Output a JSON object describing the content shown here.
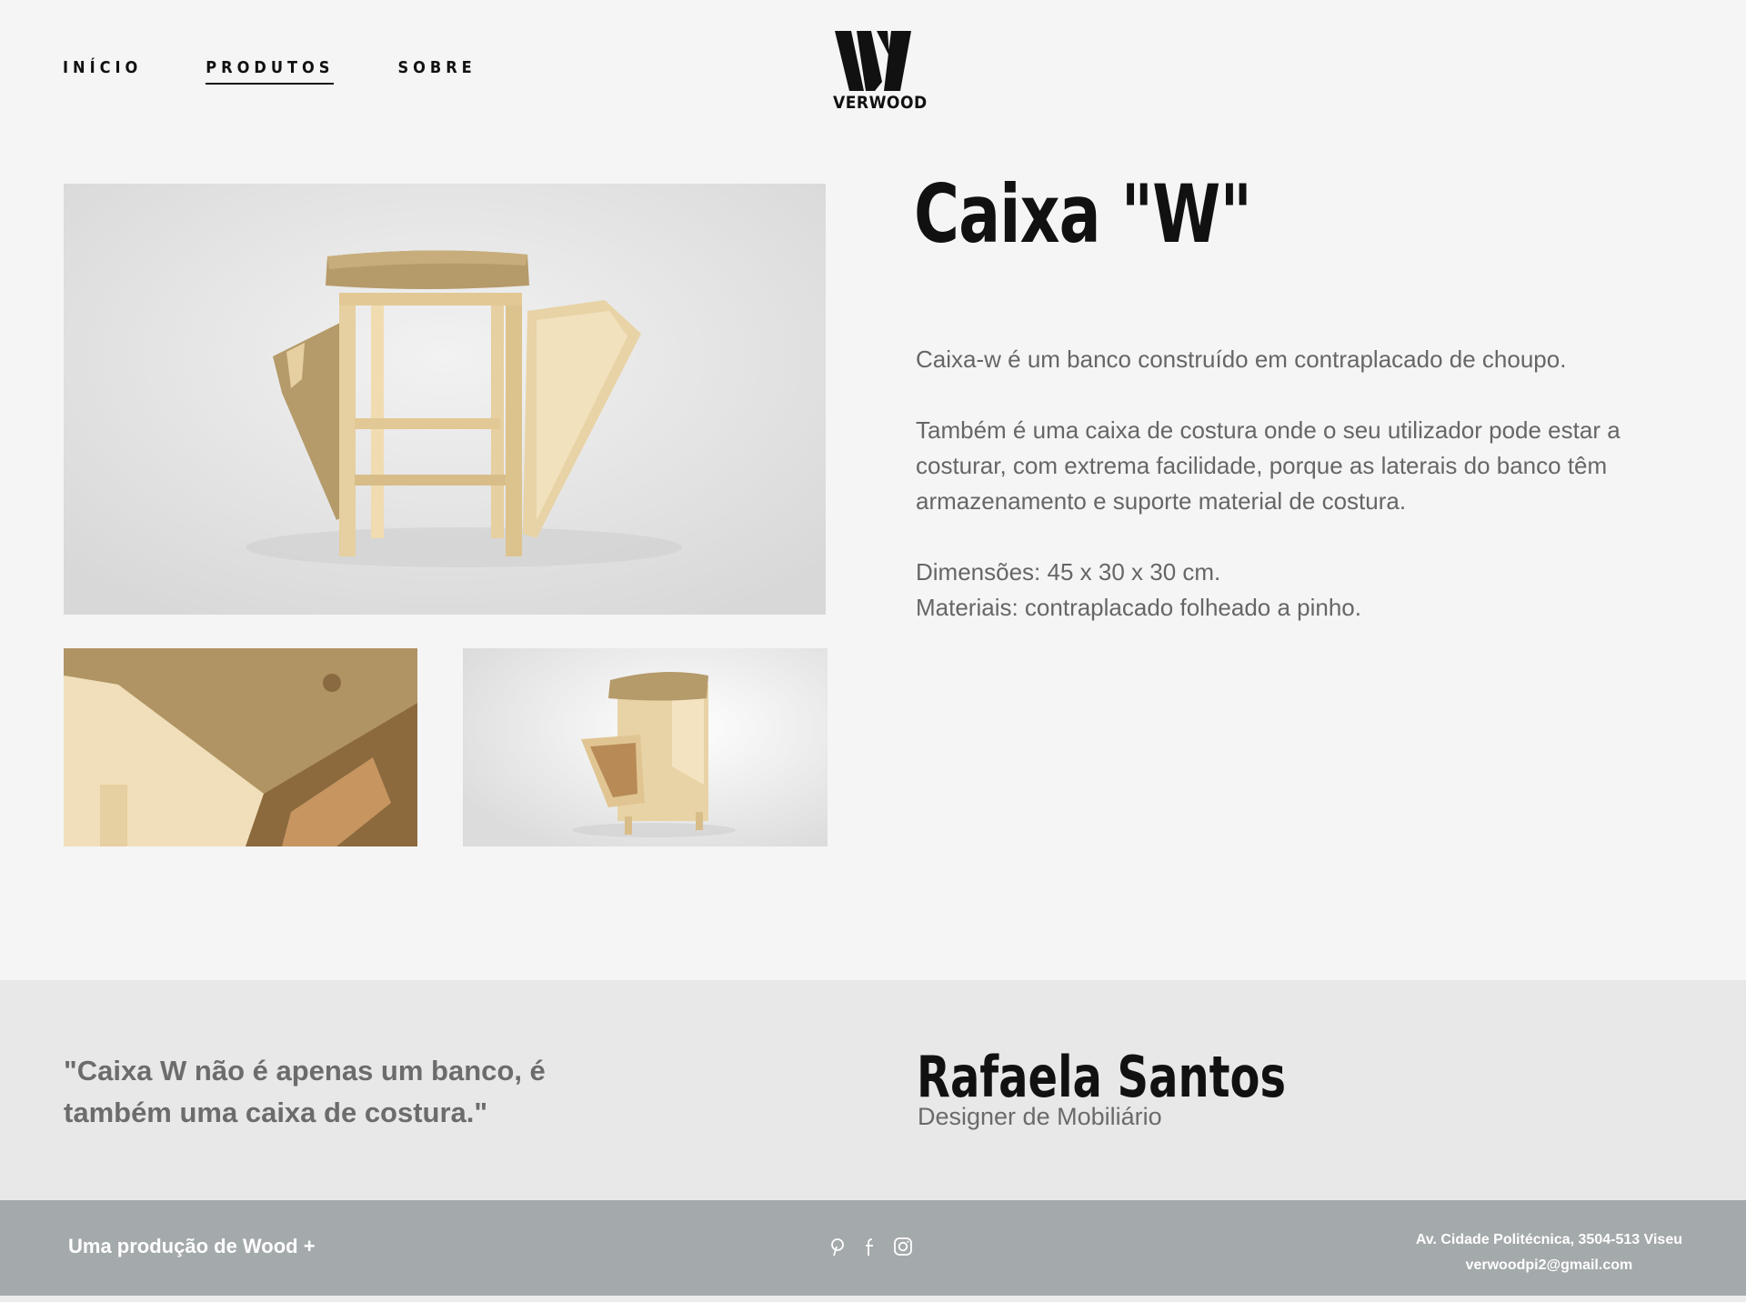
{
  "nav": {
    "items": [
      {
        "label": "INÍCIO",
        "active": false
      },
      {
        "label": "PRODUTOS",
        "active": true
      },
      {
        "label": "SOBRE",
        "active": false
      }
    ]
  },
  "logo": {
    "text": "VERWOOD"
  },
  "product": {
    "title": "Caixa \"W\"",
    "description": [
      "Caixa-w é um banco construído em contraplacado de choupo.",
      "Também é uma caixa de costura onde o seu utilizador pode estar a costurar, com extrema facilidade, porque as laterais do banco têm armazenamento e suporte material de costura."
    ],
    "dimensions": "Dimensões: 45 x 30 x 30 cm.",
    "materials": "Materiais: contraplacado folheado a pinho."
  },
  "testimonial": {
    "quote": "\"Caixa W não é apenas um banco, é também uma caixa de costura.\"",
    "name": "Rafaela Santos",
    "role": "Designer de Mobiliário"
  },
  "footer": {
    "credit": "Uma produção de Wood +",
    "address": "Av. Cidade Politécnica, 3504-513 Viseu",
    "email": "verwoodpi2@gmail.com",
    "socials": [
      "pinterest-icon",
      "facebook-icon",
      "instagram-icon"
    ]
  },
  "colors": {
    "background": "#f5f5f5",
    "testimonial_bg": "#e8e8e8",
    "footer_bg": "#a4a9ab",
    "wood": "#e6cfa0",
    "burlap": "#b59a6a"
  }
}
